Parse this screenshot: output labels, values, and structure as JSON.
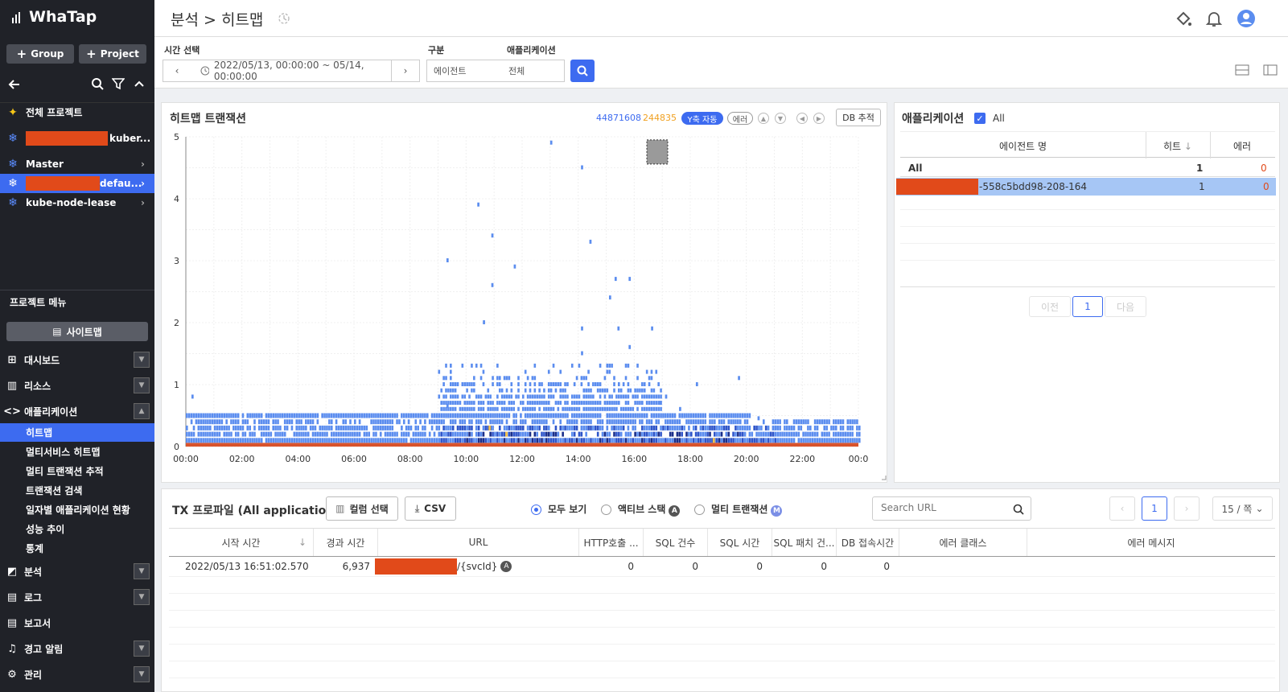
{
  "sidebar": {
    "logo": "WhaTap",
    "group_btn": "Group",
    "project_btn": "Project",
    "projects": [
      {
        "label": "전체 프로젝트",
        "icon": "puzzle-icon"
      },
      {
        "label": "kuber...",
        "icon": "kubernetes-icon"
      },
      {
        "label": "Master",
        "icon": "kubernetes-icon"
      },
      {
        "label": "defau...",
        "icon": "kubernetes-icon"
      },
      {
        "label": "kube-node-lease",
        "icon": "kubernetes-icon"
      }
    ],
    "menu_title": "프로젝트 메뉴",
    "sitemap": "사이트맵",
    "menus": {
      "dashboard": "대시보드",
      "resource": "리소스",
      "application": "애플리케이션",
      "analysis": "분석",
      "log": "로그",
      "report": "보고서",
      "alert": "경고 알림",
      "manage": "관리"
    },
    "submenus": [
      "히트맵",
      "멀티서비스 히트맵",
      "멀티 트랜잭션 추적",
      "트랜잭션 검색",
      "일자별 애플리케이션 현황",
      "성능 추이",
      "통계"
    ]
  },
  "header": {
    "breadcrumb": "분석 > 히트맵"
  },
  "filters": {
    "time_label": "시간 선택",
    "time_value": "2022/05/13, 00:00:00 ~ 05/14, 00:00:00",
    "type_label": "구분",
    "type_value": "에이전트",
    "app_label": "애플리케이션",
    "app_value": "전체"
  },
  "heatmap": {
    "title": "히트맵 트랜잭션",
    "count_total": "44871608",
    "count_error": "244835",
    "yauto": "Y축 자동",
    "error_chip": "에러",
    "db_btn": "DB 추적",
    "y_ticks": [
      "5",
      "4",
      "3",
      "2",
      "1",
      "0"
    ],
    "x_ticks": [
      "00:00",
      "02:00",
      "04:00",
      "06:00",
      "08:00",
      "10:00",
      "12:00",
      "14:00",
      "16:00",
      "18:00",
      "20:00",
      "22:00",
      "00:0"
    ]
  },
  "chart_data": {
    "type": "heatmap",
    "title": "히트맵 트랜잭션",
    "x_range": [
      "00:00",
      "24:00"
    ],
    "y_range": [
      0,
      5
    ],
    "colors": {
      "low": "#5b8def",
      "mid": "#2f55c9",
      "high": "#1a2e8a",
      "warn": "#f2c14e",
      "error_band": "#d9532c"
    }
  },
  "app_panel": {
    "title": "애플리케이션",
    "all_label": "All",
    "columns": [
      "에이전트 명",
      "히트",
      "에러"
    ],
    "rows": [
      {
        "name": "All",
        "hits": "1",
        "errors": "0"
      },
      {
        "name": "-558c5bdd98-208-164",
        "hits": "1",
        "errors": "0"
      }
    ],
    "prev": "이전",
    "page": "1",
    "next": "다음"
  },
  "profile": {
    "title": "TX 프로파일 (All applications)",
    "col_btn": "컬럼 선택",
    "csv_btn": "CSV",
    "radios": [
      "모두 보기",
      "액티브 스택",
      "멀티 트랜잭션"
    ],
    "search_placeholder": "Search URL",
    "page": "1",
    "per_page": "15 / 쪽",
    "columns": [
      "시작 시간",
      "경과 시간",
      "URL",
      "HTTP호출 ...",
      "SQL 건수",
      "SQL 시간",
      "SQL 패치 건...",
      "DB 접속시간",
      "에러 클래스",
      "에러 메시지"
    ],
    "rows": [
      {
        "start": "2022/05/13 16:51:02.570",
        "elapsed": "6,937",
        "url": "/{svcId}",
        "http": "0",
        "sql_count": "0",
        "sql_time": "0",
        "sql_fetch": "0",
        "db_conn": "0",
        "err_class": "",
        "err_msg": ""
      }
    ]
  }
}
